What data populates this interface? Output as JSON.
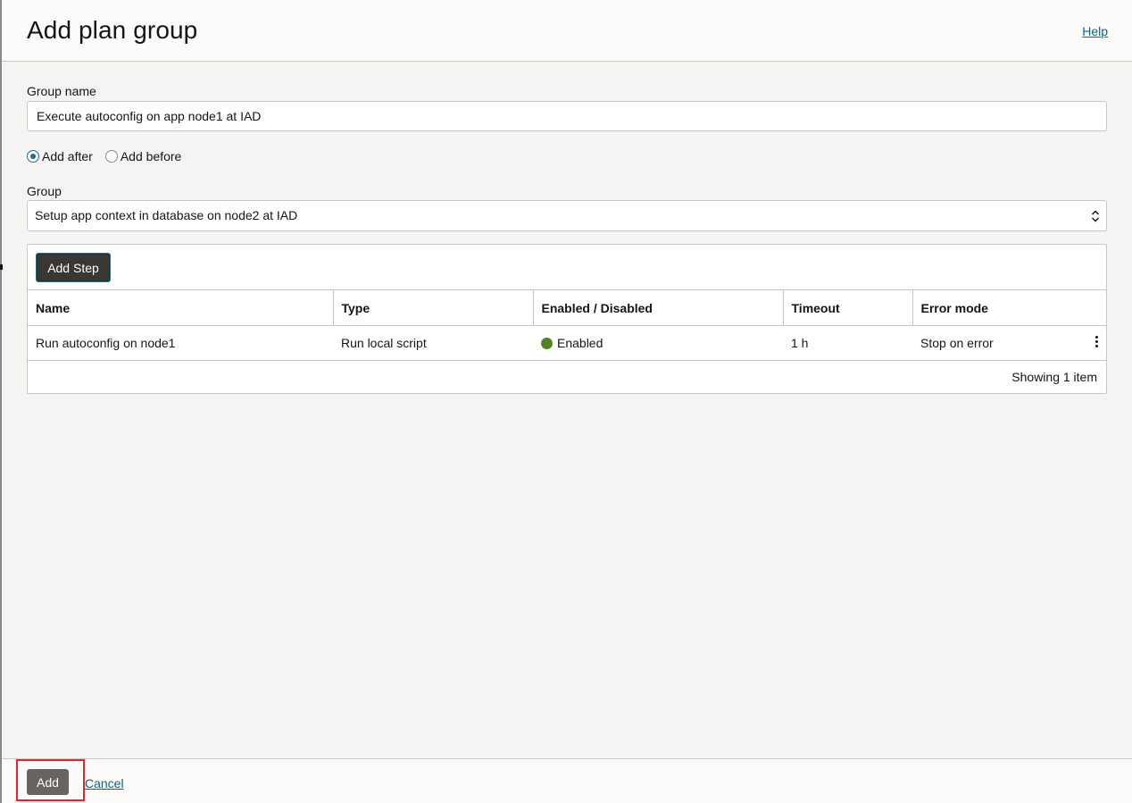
{
  "header": {
    "title": "Add plan group",
    "help_label": "Help"
  },
  "form": {
    "group_name_label": "Group name",
    "group_name_value": "Execute autoconfig on app node1 at IAD",
    "position_options": [
      {
        "label": "Add after",
        "checked": true
      },
      {
        "label": "Add before",
        "checked": false
      }
    ],
    "group_label": "Group",
    "group_selected": "Setup app context in database on node2 at IAD"
  },
  "steps_table": {
    "add_step_label": "Add Step",
    "columns": [
      "Name",
      "Type",
      "Enabled / Disabled",
      "Timeout",
      "Error mode"
    ],
    "rows": [
      {
        "name": "Run autoconfig on node1",
        "type": "Run local script",
        "status": "Enabled",
        "status_color": "#508223",
        "timeout": "1 h",
        "error_mode": "Stop on error",
        "actions_icon": "kebab-menu-icon"
      }
    ],
    "footer_text": "Showing 1 item"
  },
  "footer": {
    "add_label": "Add",
    "cancel_label": "Cancel"
  },
  "colors": {
    "link": "#00688c",
    "highlight": "#e0262b",
    "radio_selected": "#1d6d93"
  }
}
